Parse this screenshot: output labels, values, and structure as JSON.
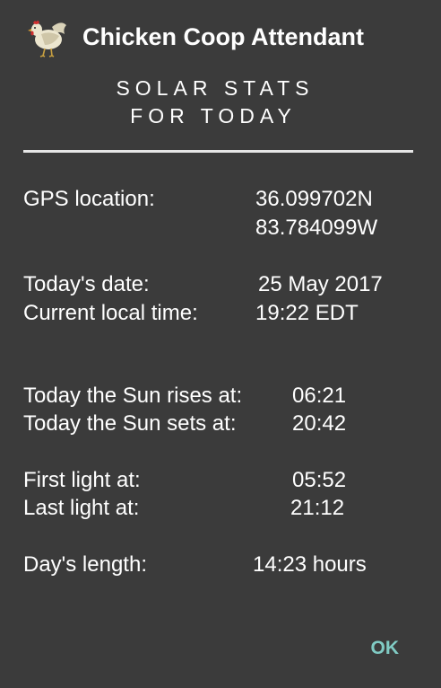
{
  "dialog": {
    "app_title": "Chicken Coop Attendant",
    "app_icon": "chicken-icon",
    "heading_line1": "SOLAR STATS",
    "heading_line2": "FOR TODAY",
    "ok_label": "OK",
    "accent_color": "#80cbc4"
  },
  "stats": {
    "gps_label": "GPS location:",
    "gps_lat": "36.099702N",
    "gps_lon": "83.784099W",
    "date_label": "Today's date:",
    "date_value": "25 May 2017",
    "time_label": "Current local time:",
    "time_value": "19:22 EDT",
    "sunrise_label": "Today the Sun rises at:",
    "sunrise_value": "06:21",
    "sunset_label": "Today the Sun sets at:",
    "sunset_value": "20:42",
    "first_light_label": "First light at:",
    "first_light_value": "05:52",
    "last_light_label": "Last light at:",
    "last_light_value": "21:12",
    "day_length_label": "Day's length:",
    "day_length_value": "14:23 hours"
  }
}
